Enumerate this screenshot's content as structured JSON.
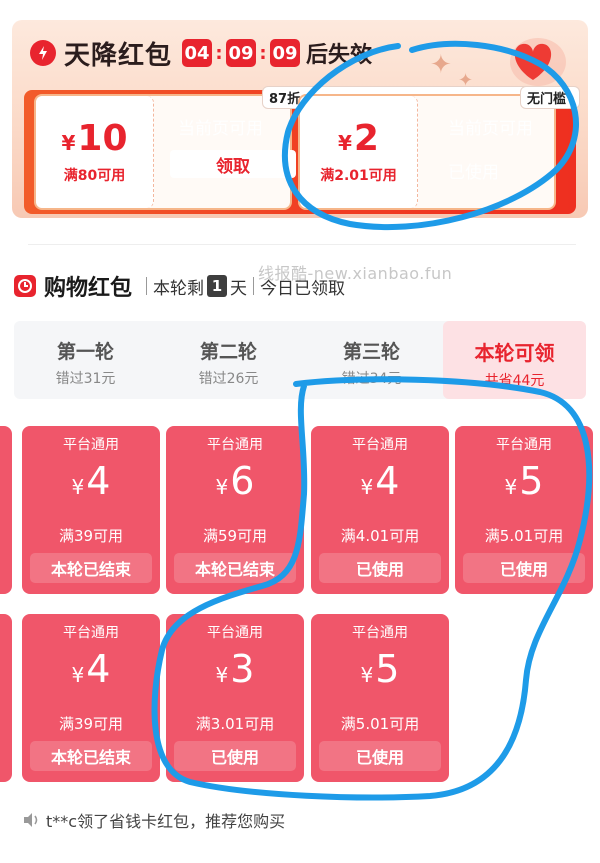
{
  "sky": {
    "title": "天降红包",
    "timer": [
      "04",
      "09",
      "09"
    ],
    "timer_suffix": "后失效",
    "cards": [
      {
        "amount": "10",
        "condition": "满80可用",
        "tag": "87折",
        "avail": "当前页可用",
        "action": "领取",
        "state": "claim"
      },
      {
        "amount": "2",
        "condition": "满2.01可用",
        "tag": "无门槛",
        "avail": "当前页可用",
        "action": "已使用",
        "state": "used"
      }
    ]
  },
  "watermark": "线报酷-new.xianbao.fun",
  "shopping": {
    "title": "购物红包",
    "remaining_prefix": "本轮剩",
    "remaining_days": "1",
    "remaining_suffix": "天",
    "today_status": "今日已领取"
  },
  "tabs": [
    {
      "label": "第一轮",
      "sub": "错过31元"
    },
    {
      "label": "第二轮",
      "sub": "错过26元"
    },
    {
      "label": "第三轮",
      "sub": "错过34元"
    },
    {
      "label": "本轮可领",
      "sub": "共省44元"
    }
  ],
  "coupons": [
    {
      "type": "平台通用",
      "amount": "4",
      "condition": "满39可用",
      "action": "本轮已结束"
    },
    {
      "type": "平台通用",
      "amount": "6",
      "condition": "满59可用",
      "action": "本轮已结束"
    },
    {
      "type": "平台通用",
      "amount": "4",
      "condition": "满4.01可用",
      "action": "已使用"
    },
    {
      "type": "平台通用",
      "amount": "5",
      "condition": "满5.01可用",
      "action": "已使用"
    },
    {
      "type": "平台通用",
      "amount": "4",
      "condition": "满39可用",
      "action": "本轮已结束"
    },
    {
      "type": "平台通用",
      "amount": "3",
      "condition": "满3.01可用",
      "action": "已使用"
    },
    {
      "type": "平台通用",
      "amount": "5",
      "condition": "满5.01可用",
      "action": "已使用"
    }
  ],
  "yen_symbol": "¥",
  "footer": {
    "text": "t**c领了省钱卡红包，推荐您购买"
  },
  "colors": {
    "brand_red": "#e8242e",
    "coupon_pink": "#f0566a",
    "annotation_blue": "#1e9be8"
  }
}
